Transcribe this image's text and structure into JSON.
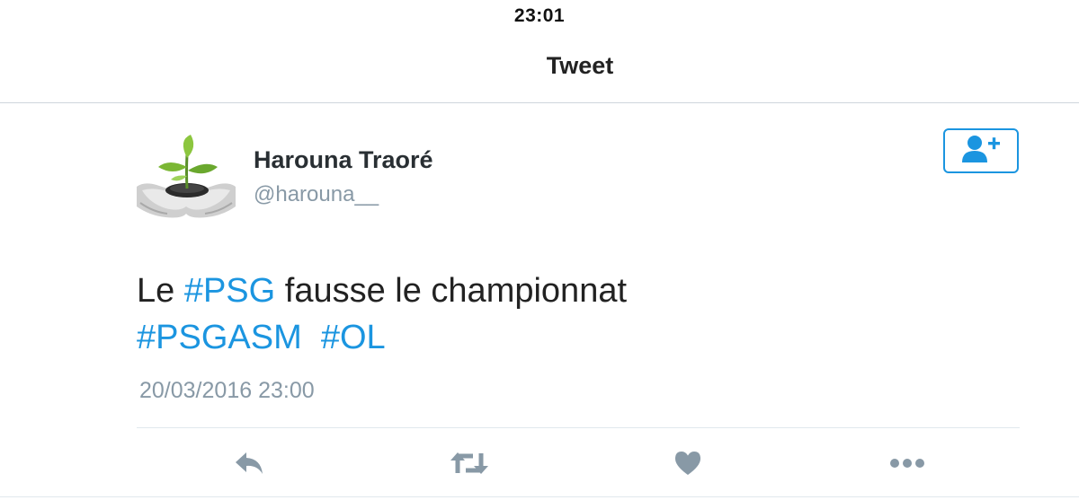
{
  "status_bar": {
    "time": "23:01"
  },
  "nav": {
    "title": "Tweet"
  },
  "tweet": {
    "user": {
      "display_name": "Harouna Traoré",
      "screen_name": "@harouna__"
    },
    "text_line1": {
      "part1": "Le ",
      "hashtag1": "#PSG",
      "part2": " fausse le championnat"
    },
    "text_line2": {
      "hashtag2": "#PSGASM",
      "gap": "  ",
      "hashtag3": "#OL"
    },
    "timestamp": "20/03/2016 23:00"
  },
  "icons": {
    "follow": "add-user-icon",
    "reply": "reply-icon",
    "retweet": "retweet-icon",
    "like": "heart-icon",
    "more": "more-icon"
  },
  "colors": {
    "accent": "#1b95e0",
    "secondary_text": "#8899a6",
    "action_icons": "#8899a6"
  }
}
